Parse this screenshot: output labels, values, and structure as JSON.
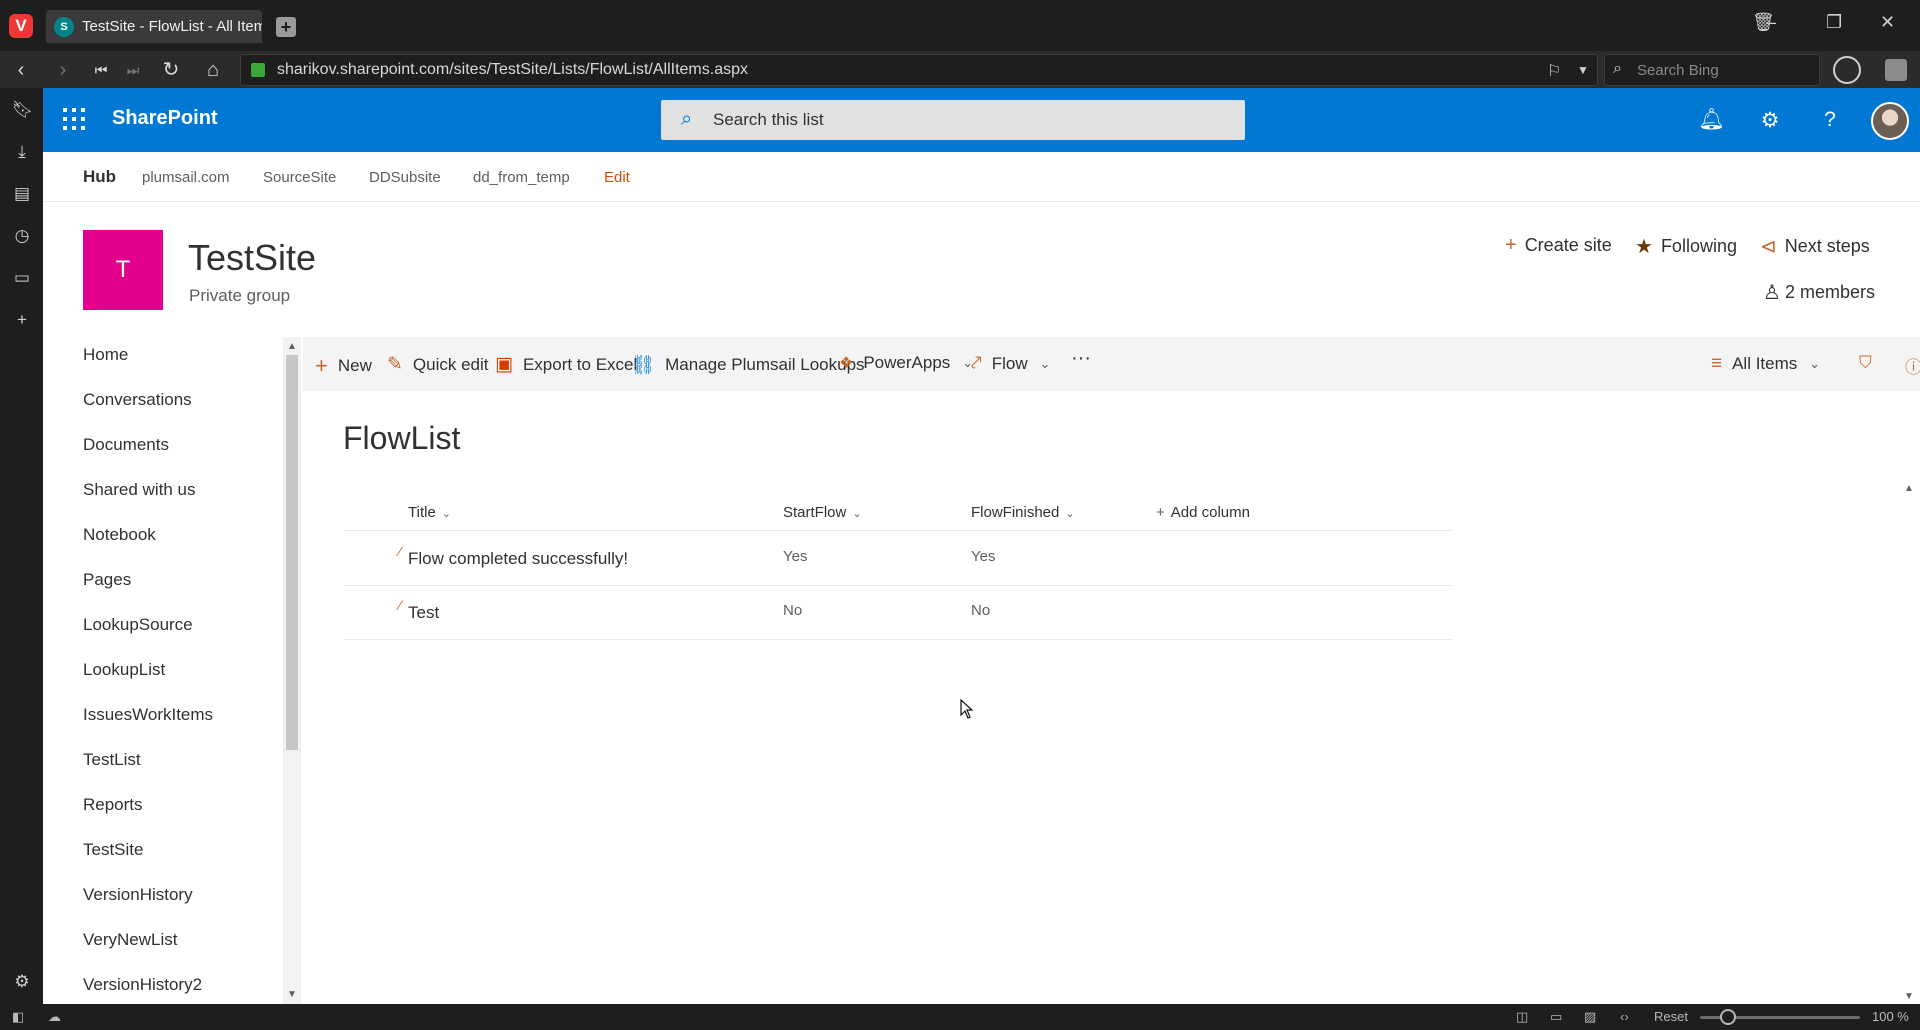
{
  "browser": {
    "tab_title": "TestSite - FlowList - All Items",
    "url": "sharikov.sharepoint.com/sites/TestSite/Lists/FlowList/AllItems.aspx",
    "search_placeholder": "Search Bing",
    "status": {
      "reset_label": "Reset",
      "zoom": "100 %"
    }
  },
  "suite": {
    "brand": "SharePoint",
    "search_placeholder": "Search this list",
    "accent": "#0078d4"
  },
  "hub": {
    "title": "Hub",
    "links": [
      "plumsail.com",
      "SourceSite",
      "DDSubsite",
      "dd_from_temp"
    ],
    "edit_label": "Edit"
  },
  "site": {
    "logo_letter": "T",
    "logo_color": "#e3008c",
    "title": "TestSite",
    "subtitle": "Private group",
    "actions": {
      "create_site": "Create site",
      "following": "Following",
      "next_steps": "Next steps",
      "members": "2 members"
    }
  },
  "leftnav": {
    "items": [
      "Home",
      "Conversations",
      "Documents",
      "Shared with us",
      "Notebook",
      "Pages",
      "LookupSource",
      "LookupList",
      "IssuesWorkItems",
      "TestList",
      "Reports",
      "TestSite",
      "VersionHistory",
      "VeryNewList",
      "VersionHistory2"
    ]
  },
  "commands": {
    "new": "New",
    "quick_edit": "Quick edit",
    "export": "Export to Excel",
    "lookups": "Manage Plumsail Lookups",
    "powerapps": "PowerApps",
    "flow": "Flow",
    "more": "···",
    "view": "All Items"
  },
  "list": {
    "title": "FlowList",
    "columns": [
      "Title",
      "StartFlow",
      "FlowFinished"
    ],
    "add_column": "Add column",
    "rows": [
      {
        "title": "Flow completed successfully!",
        "start_flow": "Yes",
        "flow_finished": "Yes"
      },
      {
        "title": "Test",
        "start_flow": "No",
        "flow_finished": "No"
      }
    ]
  }
}
